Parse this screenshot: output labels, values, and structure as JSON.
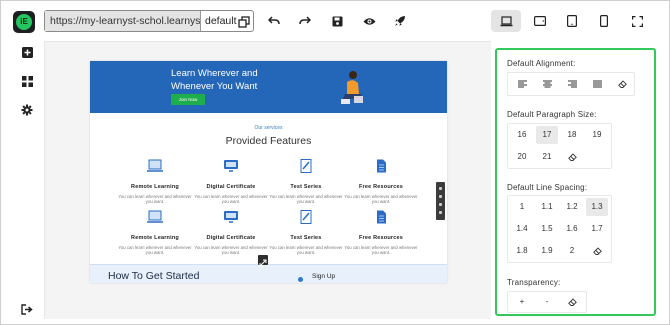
{
  "app": {
    "logo_text": "iE"
  },
  "toolbar": {
    "url": "https://my-learnyst-schol.learnyst.site/",
    "version": "default",
    "icons": [
      "undo-icon",
      "redo-icon",
      "save-icon",
      "preview-eye-icon",
      "publish-rocket-icon"
    ],
    "devices": [
      "desktop",
      "tablet-landscape",
      "tablet",
      "mobile",
      "fullscreen"
    ],
    "active_device": "desktop"
  },
  "sidebar": {
    "icons": [
      "add-icon",
      "widgets-icon",
      "settings-icon",
      "exit-icon"
    ]
  },
  "preview": {
    "hero_title": "Learn Wherever and Whenever You Want",
    "hero_button": "Join Now",
    "services_label": "Our services",
    "features_title": "Provided Features",
    "features": [
      {
        "title": "Remote Learning",
        "desc": "You can learn wherever and whenever you want."
      },
      {
        "title": "Digital Certificate",
        "desc": "You can learn wherever and whenever you want."
      },
      {
        "title": "Test Series",
        "desc": "You can learn wherever and whenever you want."
      },
      {
        "title": "Free Resources",
        "desc": "You can learn wherever and whenever you want."
      },
      {
        "title": "Remote Learning",
        "desc": "You can learn wherever and whenever you want."
      },
      {
        "title": "Digital Certificate",
        "desc": "You can learn wherever and whenever you want."
      },
      {
        "title": "Test Series",
        "desc": "You can learn wherever and whenever you want."
      },
      {
        "title": "Free Resources",
        "desc": "You can learn wherever and whenever you want."
      }
    ],
    "started_title": "How To Get Started",
    "started_step": "Sign Up"
  },
  "panel": {
    "alignment_title": "Default Alignment:",
    "alignment_options": [
      "align-left",
      "align-center",
      "align-right",
      "align-justify",
      "clear"
    ],
    "paragraph_title": "Default Paragraph Size:",
    "paragraph_sizes": [
      "16",
      "17",
      "18",
      "19",
      "20",
      "21"
    ],
    "paragraph_selected": "17",
    "line_spacing_title": "Default Line Spacing:",
    "line_spacings": [
      "1",
      "1.1",
      "1.2",
      "1.3",
      "1.4",
      "1.5",
      "1.6",
      "1.7",
      "1.8",
      "1.9",
      "2"
    ],
    "line_spacing_selected": "1.3",
    "transparency_title": "Transparency:",
    "transparency_options": [
      "+",
      "-"
    ],
    "accent_color": "#34c759"
  }
}
